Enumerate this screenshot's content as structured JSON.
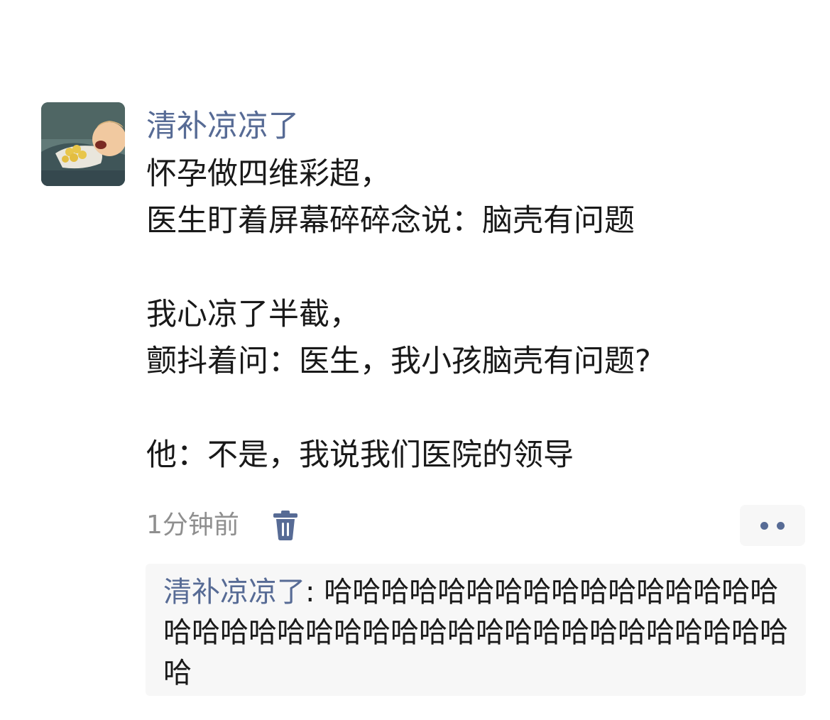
{
  "post": {
    "author": "清补凉凉了",
    "lines": [
      "怀孕做四维彩超，",
      "医生盯着屏幕碎碎念说：脑壳有问题",
      "",
      "我心凉了半截，",
      "颤抖着问：医生，我小孩脑壳有问题?",
      "",
      "他：不是，我说我们医院的领导"
    ],
    "time": "1分钟前",
    "delete_icon": "trash-icon",
    "more_icon": "more-dots-icon"
  },
  "comments": [
    {
      "author": "清补凉凉了",
      "separator": ": ",
      "text": "哈哈哈哈哈哈哈哈哈哈哈哈哈哈哈哈哈哈哈哈哈哈哈哈哈哈哈哈哈哈哈哈哈哈哈哈哈哈哈"
    }
  ],
  "colors": {
    "link": "#576b95",
    "text": "#191919",
    "meta": "#8f8f8f",
    "comment_bg": "#f7f7f7"
  }
}
